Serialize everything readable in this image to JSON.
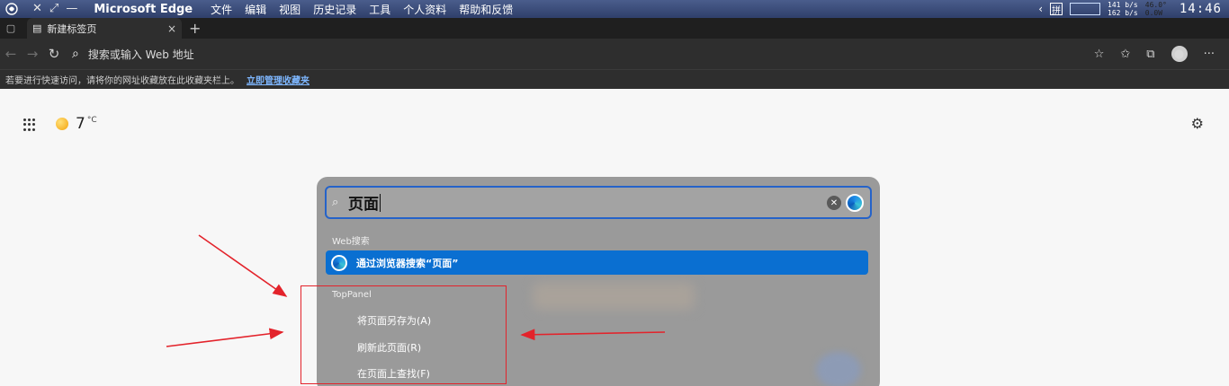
{
  "system_bar": {
    "app_name": "Microsoft Edge",
    "menu": [
      "文件",
      "编辑",
      "视图",
      "历史记录",
      "工具",
      "个人资料",
      "帮助和反馈"
    ],
    "ime": "拼",
    "net_up": "141 b/s",
    "net_down": "162 b/s",
    "temp_a": "46.0°",
    "temp_b": "0.0W",
    "clock": "14:46"
  },
  "tab": {
    "title": "新建标签页",
    "close": "×",
    "new_tab": "+"
  },
  "address_bar": {
    "placeholder": "搜索或输入 Web 地址"
  },
  "favorites_hint": {
    "text": "若要进行快速访问，请将你的网址收藏放在此收藏夹栏上。",
    "link": "立即管理收藏夹"
  },
  "weather": {
    "temperature": "7",
    "unit": "°C"
  },
  "search_popup": {
    "query": "页面",
    "web_section": "Web搜索",
    "web_result": "通过浏览器搜索“页面”",
    "panel_section": "TopPanel",
    "items": [
      "将页面另存为(A)",
      "刷新此页面(R)",
      "在页面上查找(F)"
    ]
  },
  "colors": {
    "accent": "#0a6fd1",
    "annotation": "#e3232b"
  }
}
